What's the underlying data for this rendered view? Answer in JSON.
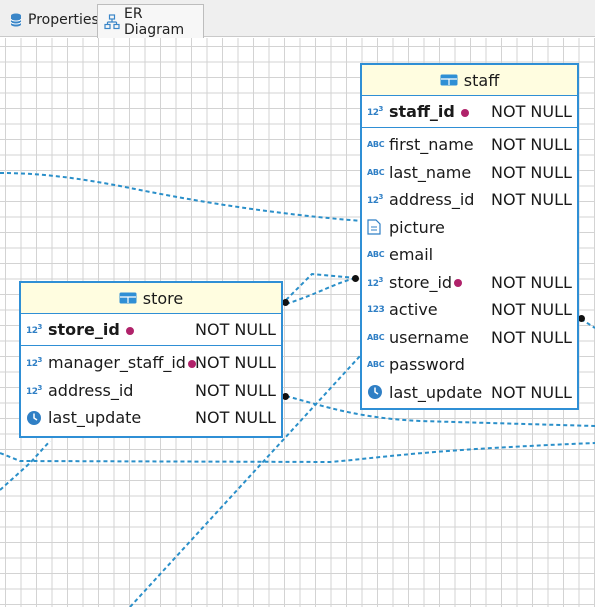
{
  "tabs": [
    {
      "label": "Properties",
      "icon": "database-icon",
      "active": false
    },
    {
      "label": "ER Diagram",
      "icon": "er-diagram-icon",
      "active": true
    }
  ],
  "colors": {
    "accent": "#2f8fd5",
    "header_bg": "#fffde0",
    "key_dot": "#b0226a",
    "link": "#2a8fc9"
  },
  "entities": {
    "staff": {
      "name": "staff",
      "columns": [
        {
          "name": "staff_id",
          "type_icon": "numeric-key-icon",
          "null": "NOT NULL",
          "pk": true,
          "key_dot": true
        },
        {
          "name": "first_name",
          "type_icon": "text-icon",
          "null": "NOT NULL"
        },
        {
          "name": "last_name",
          "type_icon": "text-icon",
          "null": "NOT NULL"
        },
        {
          "name": "address_id",
          "type_icon": "numeric-key-icon",
          "null": "NOT NULL"
        },
        {
          "name": "picture",
          "type_icon": "binary-icon",
          "null": ""
        },
        {
          "name": "email",
          "type_icon": "text-icon",
          "null": ""
        },
        {
          "name": "store_id",
          "type_icon": "numeric-key-icon",
          "null": "NOT NULL",
          "key_dot": true
        },
        {
          "name": "active",
          "type_icon": "numeric-icon",
          "null": "NOT NULL"
        },
        {
          "name": "username",
          "type_icon": "text-icon",
          "null": "NOT NULL"
        },
        {
          "name": "password",
          "type_icon": "text-icon",
          "null": ""
        },
        {
          "name": "last_update",
          "type_icon": "clock-icon",
          "null": "NOT NULL"
        }
      ]
    },
    "store": {
      "name": "store",
      "columns": [
        {
          "name": "store_id",
          "type_icon": "numeric-key-icon",
          "null": "NOT NULL",
          "pk": true,
          "key_dot": true
        },
        {
          "name": "manager_staff_id",
          "type_icon": "numeric-key-icon",
          "null": "NOT NULL",
          "key_dot": true
        },
        {
          "name": "address_id",
          "type_icon": "numeric-key-icon",
          "null": "NOT NULL"
        },
        {
          "name": "last_update",
          "type_icon": "clock-icon",
          "null": "NOT NULL"
        }
      ]
    }
  }
}
